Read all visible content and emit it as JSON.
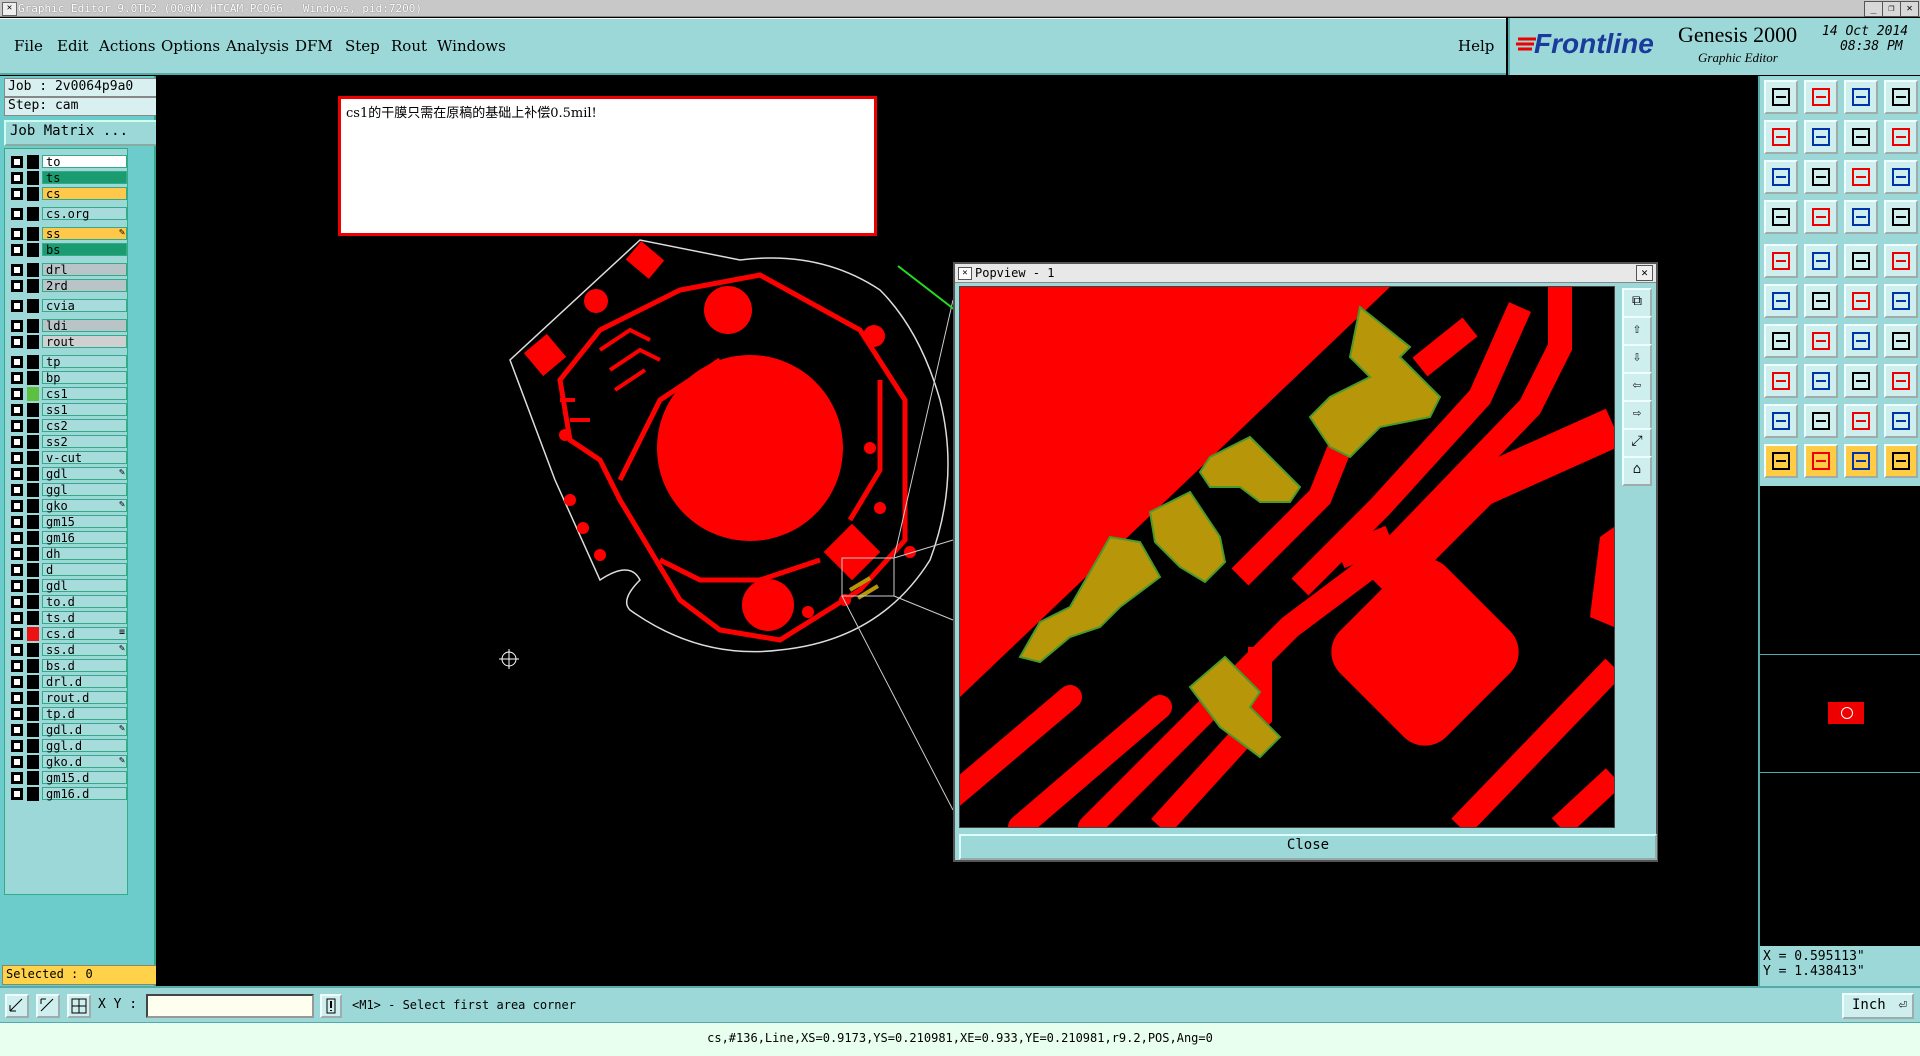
{
  "window": {
    "title": "Graphic Editor 9.0Tb2 (00@NY-HTCAM-PC066 - Windows, pid:7200)",
    "controls": [
      "_",
      "❐",
      "✕"
    ]
  },
  "menu": {
    "items": [
      "File",
      "Edit",
      "Actions",
      "Options",
      "Analysis",
      "DFM",
      "Step",
      "Rout",
      "Windows"
    ],
    "help": "Help"
  },
  "brand": {
    "logo": "Frontline",
    "product": "Genesis 2000",
    "subtitle": "Graphic Editor",
    "date": "14 Oct 2014",
    "time": "08:38 PM"
  },
  "job": {
    "job": "Job : 2v0064p9a0",
    "step": "Step: cam",
    "matrix_button": "Job Matrix ..."
  },
  "layers": [
    {
      "name": "to",
      "color": "#ffffff"
    },
    {
      "name": "ts",
      "color": "#1a9c70"
    },
    {
      "name": "cs",
      "color": "#ffc84a"
    },
    {
      "name": "cs.org",
      "color": "#a8dcdc"
    },
    {
      "name": "ss",
      "color": "#ffc84a",
      "mark": "✎"
    },
    {
      "name": "bs",
      "color": "#1a9c70"
    },
    {
      "name": "drl",
      "color": "#b8c4c8"
    },
    {
      "name": "2rd",
      "color": "#b8c4c8"
    },
    {
      "name": "cvia",
      "color": "#a8dcdc"
    },
    {
      "name": "ldi",
      "color": "#b8c4c8"
    },
    {
      "name": "rout",
      "color": "#d0d0d0"
    },
    {
      "name": "tp",
      "color": "#a8dcdc"
    },
    {
      "name": "bp",
      "color": "#a8dcdc"
    },
    {
      "name": "cs1",
      "color": "#a8dcdc",
      "swatch": "#5cc040"
    },
    {
      "name": "ss1",
      "color": "#a8dcdc"
    },
    {
      "name": "cs2",
      "color": "#a8dcdc"
    },
    {
      "name": "ss2",
      "color": "#a8dcdc"
    },
    {
      "name": "v-cut",
      "color": "#a8dcdc"
    },
    {
      "name": "gdl",
      "color": "#a8dcdc",
      "mark": "✎"
    },
    {
      "name": "ggl",
      "color": "#a8dcdc"
    },
    {
      "name": "gko",
      "color": "#a8dcdc",
      "mark": "✎"
    },
    {
      "name": "gm15",
      "color": "#a8dcdc"
    },
    {
      "name": "gm16",
      "color": "#a8dcdc"
    },
    {
      "name": "dh",
      "color": "#a8dcdc"
    },
    {
      "name": "d",
      "color": "#a8dcdc"
    },
    {
      "name": "gdl",
      "color": "#a8dcdc"
    },
    {
      "name": "to.d",
      "color": "#a8dcdc"
    },
    {
      "name": "ts.d",
      "color": "#a8dcdc"
    },
    {
      "name": "cs.d",
      "color": "#a8dcdc",
      "swatch": "#ee1111",
      "mark": "≡"
    },
    {
      "name": "ss.d",
      "color": "#a8dcdc",
      "mark": "✎"
    },
    {
      "name": "bs.d",
      "color": "#a8dcdc"
    },
    {
      "name": "drl.d",
      "color": "#a8dcdc"
    },
    {
      "name": "rout.d",
      "color": "#a8dcdc"
    },
    {
      "name": "tp.d",
      "color": "#a8dcdc"
    },
    {
      "name": "gdl.d",
      "color": "#a8dcdc",
      "mark": "✎"
    },
    {
      "name": "ggl.d",
      "color": "#a8dcdc"
    },
    {
      "name": "gko.d",
      "color": "#a8dcdc",
      "mark": "✎"
    },
    {
      "name": "gm15.d",
      "color": "#a8dcdc"
    },
    {
      "name": "gm16.d",
      "color": "#a8dcdc"
    }
  ],
  "selected": "Selected : 0",
  "note": {
    "text": "cs1的干膜只需在原稿的基础上补偿0.5mil!"
  },
  "popview": {
    "title": "Popview - 1",
    "close_label": "Close"
  },
  "coords": {
    "x": "X = 0.595113\"",
    "y": "Y = 1.438413\""
  },
  "bottom": {
    "xy_label": "X Y :",
    "input_value": "",
    "prompt": "<M1> - Select first area corner",
    "unit": "Inch"
  },
  "status": "cs,#136,Line,XS=0.9173,YS=0.210981,XE=0.933,YE=0.210981,r9.2,POS,Ang=0",
  "colors": {
    "copper": "#ff0000",
    "pad": "#b8960a",
    "panel": "#9cd8d8",
    "arrow": "#22dd22"
  }
}
